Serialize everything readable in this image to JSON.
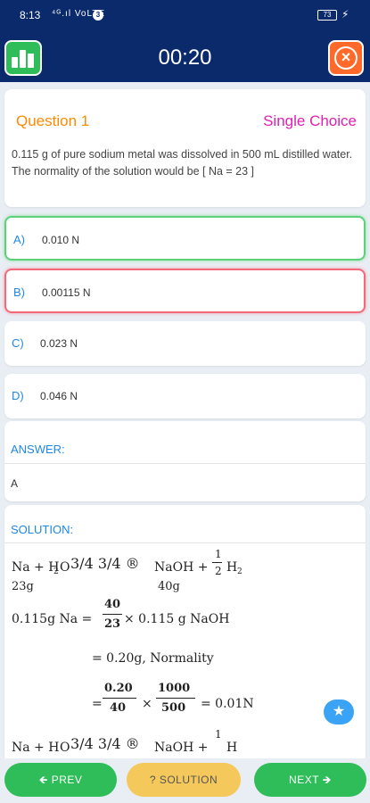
{
  "status_bar": {
    "time": "8:13",
    "signal": "⁴ᴳ.ıl VoLTE",
    "notif": "3",
    "battery": "73",
    "charging": "⚡"
  },
  "header": {
    "timer": "00:20",
    "stats_icon": "bar-chart-icon",
    "close_icon": "close-icon"
  },
  "question": {
    "number_label": "Question 1",
    "type_label": "Single Choice",
    "text": "0.115 g of pure sodium metal was dissolved in 500 mL distilled water. The normality of the solution would be [ Na = 23 ]"
  },
  "options": [
    {
      "letter": "A)",
      "value": "0.010 N",
      "state": "correct"
    },
    {
      "letter": "B)",
      "value": "0.00115 N",
      "state": "wrong"
    },
    {
      "letter": "C)",
      "value": "0.023 N",
      "state": "none"
    },
    {
      "letter": "D)",
      "value": "0.046 N",
      "state": "none"
    }
  ],
  "answer": {
    "title": "ANSWER:",
    "value": "A"
  },
  "solution": {
    "title": "SOLUTION:",
    "line1_lhs": "Na + H",
    "line1_mid": "O",
    "line1_frac": "3/4 3/4 ®",
    "line1_rhs": "NaOH +",
    "line1_half_num": "1",
    "line1_half_den": "2",
    "line1_h": "H",
    "line1_sub": "2",
    "under_na": "23g",
    "under_naoh": "40g",
    "line2_lhs": "0.115g Na =",
    "line2_num": "40",
    "line2_den": "23",
    "line2_rhs": "× 0.115 g NaOH",
    "line3": "= 0.20g, Normality",
    "line4_eq": "=",
    "line4_num1": "0.20",
    "line4_den1": "40",
    "line4_x": "×",
    "line4_num2": "1000",
    "line4_den2": "500",
    "line4_res": "= 0.01N"
  },
  "footer": {
    "prev": "PREV",
    "solution": "? SOLUTION",
    "next": "NEXT"
  },
  "colors": {
    "header": "#0a2a6b",
    "green": "#2ebd59",
    "orange": "#ff8a00",
    "magenta": "#e020b0",
    "blue": "#1e88e5",
    "yellow": "#f4c85a"
  }
}
